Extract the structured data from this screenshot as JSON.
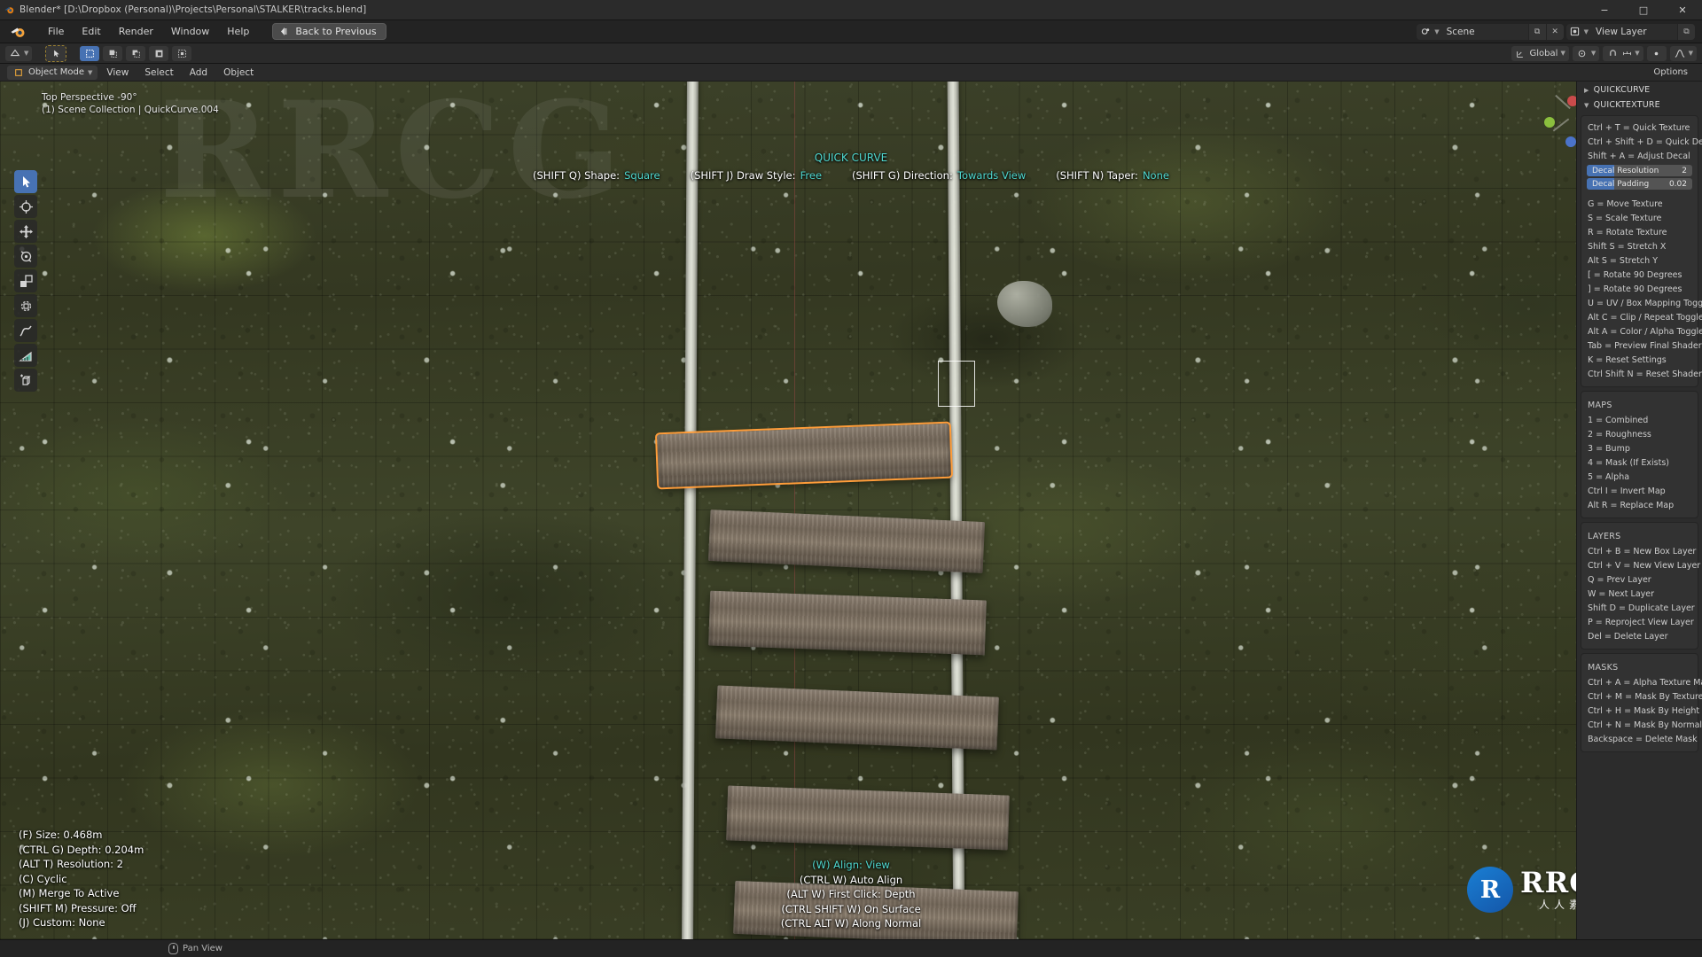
{
  "window": {
    "title": "Blender* [D:\\Dropbox (Personal)\\Projects\\Personal\\STALKER\\tracks.blend]",
    "app_icon": "blender-icon",
    "minimize": "−",
    "maximize": "□",
    "close": "✕"
  },
  "menubar": {
    "logo": "blender-logo-icon",
    "items": [
      "File",
      "Edit",
      "Render",
      "Window",
      "Help"
    ],
    "back_to_previous": "Back to Previous",
    "scene_field": {
      "icon": "scene-icon",
      "value": "Scene",
      "copy_icon": "new-scene-icon",
      "x_icon": "✕"
    },
    "view_layer_field": {
      "icon": "view-layer-icon",
      "value": "View Layer",
      "copy_icon": "new-view-layer-icon"
    }
  },
  "viewport_header": {
    "editor_type": "editor-type-icon",
    "select_tool": "tweak-select-icon",
    "select_modes": [
      "select-new-icon",
      "select-extend-icon",
      "select-subtract-icon",
      "select-invert-icon",
      "select-intersect-icon"
    ],
    "transform_orientation": {
      "icon": "orientation-icon",
      "value": "Global"
    },
    "pivot_point": {
      "icon": "pivot-icon"
    },
    "snap": {
      "magnet_icon": "magnet-icon",
      "snap_to_icon": "snap-increment-icon"
    },
    "proportional_edit": {
      "icon": "proportional-edit-icon",
      "falloff_icon": "falloff-curve-icon"
    }
  },
  "viewport_header2": {
    "mode": "Object Mode",
    "menus": [
      "View",
      "Select",
      "Add",
      "Object"
    ],
    "options_label": "Options"
  },
  "viewport": {
    "info_line1": "Top Perspective -90°",
    "info_line2": "(1) Scene Collection | QuickCurve.004",
    "overlay_title": "QUICK CURVE",
    "overlay_options": [
      {
        "key": "(SHIFT Q) Shape:",
        "value": "Square"
      },
      {
        "key": "(SHIFT J) Draw Style:",
        "value": "Free"
      },
      {
        "key": "(SHIFT G) Direction:",
        "value": "Towards View"
      },
      {
        "key": "(SHIFT N) Taper:",
        "value": "None"
      }
    ],
    "hud_left": [
      "(F) Size: 0.468m",
      "(CTRL G) Depth: 0.204m",
      "(ALT T) Resolution: 2",
      "(C) Cyclic",
      "(M) Merge To Active",
      "(SHIFT M) Pressure: Off",
      "(J) Custom: None"
    ],
    "hud_bottom_title": "(W) Align: View",
    "hud_bottom": [
      "(CTRL W) Auto Align",
      "(ALT W) First Click: Depth",
      "(CTRL SHIFT W) On Surface",
      "(CTRL ALT W) Along Normal"
    ],
    "tools": [
      "tweak-select-icon",
      "cursor-icon",
      "move-icon",
      "rotate-icon",
      "scale-icon",
      "transform-icon",
      "annotate-icon",
      "measure-icon",
      "add-cube-icon"
    ],
    "gizmo": {
      "x_axis": "x-axis-ball",
      "y_axis": "y-axis-ball",
      "z_axis": "z-axis-ball"
    },
    "nav_icons": [
      "zoom-icon",
      "move-view-icon",
      "camera-view-icon",
      "ortho-persp-icon"
    ]
  },
  "npanel": {
    "tabs": [
      "QUICKCURVE",
      "QUICKTEXTURE"
    ],
    "shortcuts_top": [
      "Ctrl + T = Quick Texture",
      "Ctrl + Shift + D = Quick Decal",
      "Shift + A = Adjust Decal"
    ],
    "sliders": [
      {
        "label": "Decal Resolution",
        "value": "2",
        "fill_pct": 26
      },
      {
        "label": "Decal Padding",
        "value": "0.02",
        "fill_pct": 26
      }
    ],
    "shortcuts_mid": [
      "G = Move Texture",
      "S = Scale Texture",
      "R = Rotate Texture",
      "Shift S = Stretch X",
      "Alt S = Stretch Y",
      "[ = Rotate 90 Degrees",
      "] = Rotate 90 Degrees",
      "U = UV / Box Mapping Toggle",
      "Alt C = Clip / Repeat Toggle",
      "Alt A = Color / Alpha Toggle",
      "Tab = Preview Final Shader",
      "K = Reset Settings",
      "Ctrl Shift N = Reset Shader"
    ],
    "sections": [
      {
        "title": "MAPS",
        "items": [
          "1 = Combined",
          "2 = Roughness",
          "3 = Bump",
          "4 = Mask (If Exists)",
          "5 = Alpha",
          "Ctrl I = Invert Map",
          "Alt R = Replace Map"
        ]
      },
      {
        "title": "LAYERS",
        "items": [
          "Ctrl + B = New Box Layer",
          "Ctrl + V = New View Layer",
          "Q = Prev Layer",
          "W = Next Layer",
          "Shift D = Duplicate Layer",
          "P = Reproject View Layer",
          "Del = Delete Layer"
        ]
      },
      {
        "title": "MASKS",
        "items": [
          "Ctrl + A = Alpha Texture Mask",
          "Ctrl + M = Mask By Texture",
          "Ctrl + H = Mask By Height",
          "Ctrl + N = Mask By Normal",
          "Backspace = Delete Mask"
        ]
      }
    ]
  },
  "statusbar": {
    "mouse_action": "Pan View",
    "mouse_icon": "middle-mouse-icon"
  },
  "watermark": {
    "big": "RRCG",
    "logo_letter": "R",
    "brand": "RRCG",
    "subtitle": "人人素材"
  },
  "colors": {
    "accent_blue": "#4772b3",
    "cyan_text": "#4fd8d0",
    "selection_orange": "#ff9d3a",
    "panel_bg": "#2c2c2c",
    "header_bg": "#2a2a2a"
  }
}
